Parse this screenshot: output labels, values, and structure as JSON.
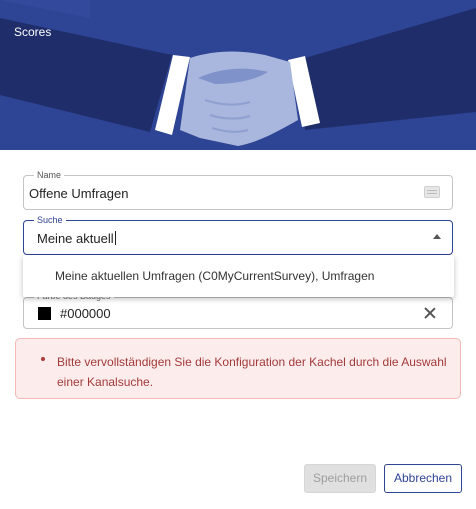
{
  "header": {
    "title": "Scores"
  },
  "form": {
    "name": {
      "label": "Name",
      "value": "Offene Umfragen"
    },
    "search": {
      "label": "Suche",
      "value": "Meine aktuell"
    },
    "dropdown_option": "Meine aktuellen Umfragen (C0MyCurrentSurvey), Umfragen",
    "color": {
      "label": "Farbe des Badges",
      "value": "#000000"
    }
  },
  "error": {
    "message": "Bitte vervollständigen Sie die Konfiguration der Kachel durch die Auswahl einer Kanalsuche."
  },
  "buttons": {
    "save": "Speichern",
    "cancel": "Abbrechen"
  },
  "colors": {
    "brand": "#2e4494",
    "banner_dark": "#1f2e6b",
    "error_bg": "#fdecec",
    "error_text": "#a33a3a"
  }
}
